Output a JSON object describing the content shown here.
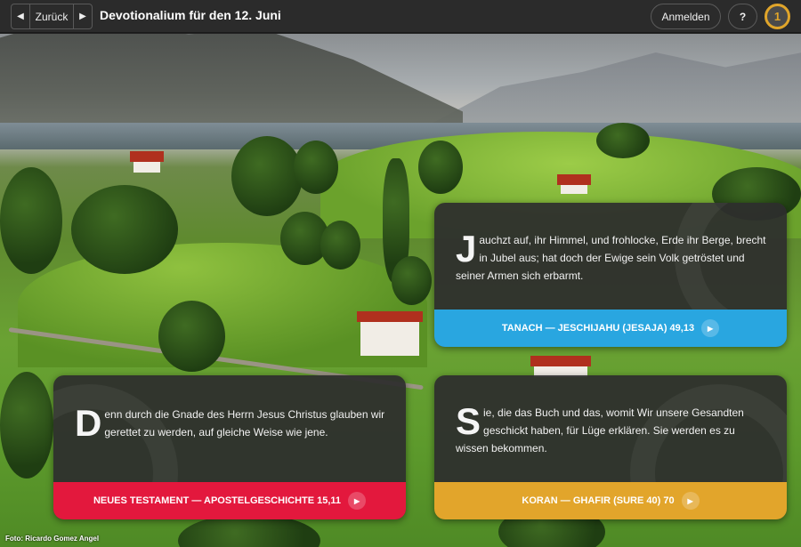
{
  "topbar": {
    "back_label": "Zurück",
    "prev_arrow": "◀",
    "next_arrow": "▶",
    "title": "Devotionalium für den 12. Juni",
    "login_label": "Anmelden",
    "help_label": "?",
    "logo_text": "1",
    "logo_color": "#e0a52a"
  },
  "cards": [
    {
      "dropcap": "J",
      "text": "auchzt auf, ihr Himmel, und frohlocke, Erde ihr Berge, brecht in Jubel aus; hat doch der Ewige sein Volk getröstet und seiner Armen sich erbarmt.",
      "source": "TANACH — JESCHIJAHU (JESAJA) 49,13",
      "color": "#29a6e0"
    },
    {
      "dropcap": "D",
      "text": "enn durch die Gnade des Herrn Jesus Christus glauben wir gerettet zu werden, auf gleiche Weise wie jene.",
      "source": "NEUES TESTAMENT — APOSTELGESCHICHTE 15,11",
      "color": "#e3183d"
    },
    {
      "dropcap": "S",
      "text": "ie, die das Buch und das, womit Wir unsere Gesandten geschickt haben, für Lüge erklären. Sie werden es zu wissen bekommen.",
      "source": "KORAN — GHAFIR (SURE 40) 70",
      "color": "#e2a52b"
    }
  ],
  "play_icon": "▶",
  "photo_credit": "Foto: Ricardo Gomez Angel"
}
